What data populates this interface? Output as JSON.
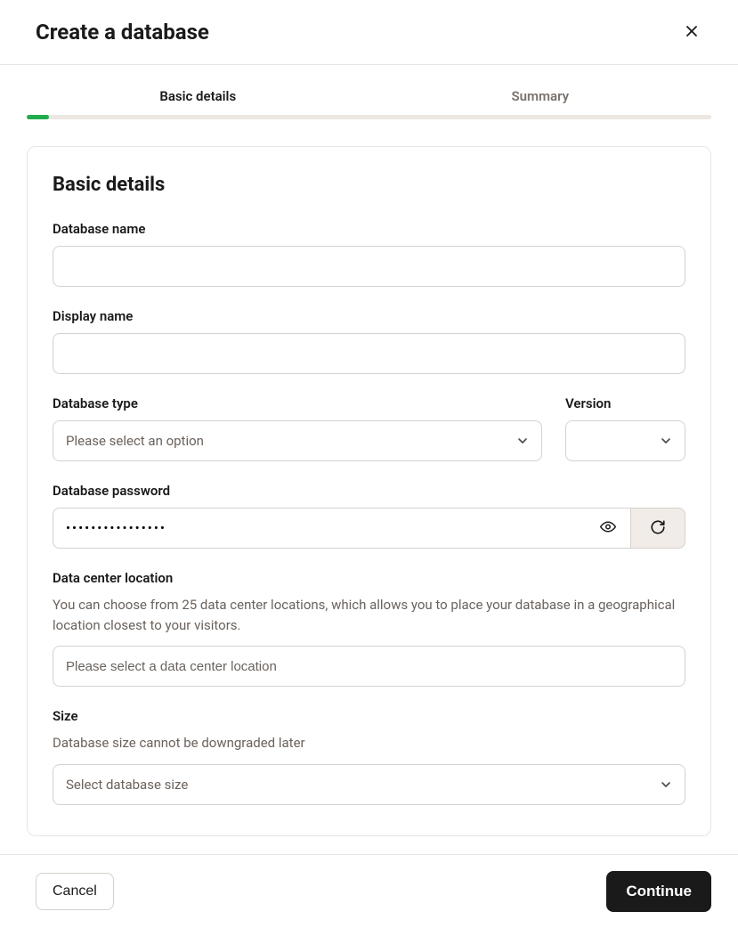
{
  "header": {
    "title": "Create a database"
  },
  "tabs": {
    "basic": "Basic details",
    "summary": "Summary"
  },
  "card": {
    "title": "Basic details"
  },
  "fields": {
    "dbname": {
      "label": "Database name",
      "value": ""
    },
    "displayname": {
      "label": "Display name",
      "value": ""
    },
    "dbtype": {
      "label": "Database type",
      "placeholder": "Please select an option"
    },
    "version": {
      "label": "Version",
      "value": ""
    },
    "password": {
      "label": "Database password",
      "value": "••••••••••••••••"
    },
    "datacenter": {
      "label": "Data center location",
      "help": "You can choose from 25 data center locations, which allows you to place your database in a geographical location closest to your visitors.",
      "placeholder": "Please select a data center location"
    },
    "size": {
      "label": "Size",
      "help": "Database size cannot be downgraded later",
      "placeholder": "Select database size"
    }
  },
  "footer": {
    "cancel": "Cancel",
    "continue": "Continue"
  }
}
